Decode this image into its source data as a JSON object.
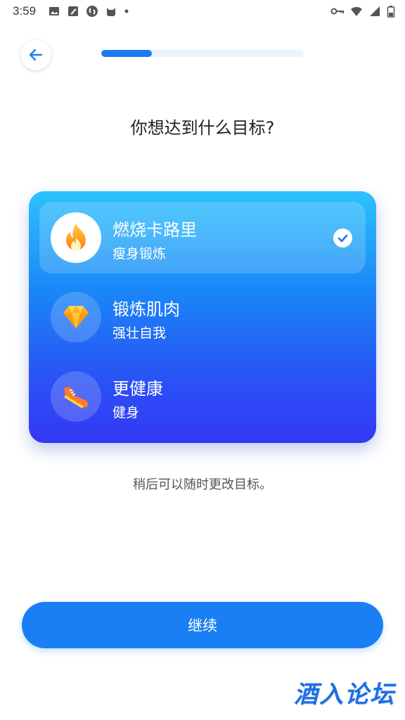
{
  "status_bar": {
    "time": "3:59",
    "left_icons": [
      "image-icon",
      "note-icon",
      "shazam-icon",
      "cat-icon",
      "dot-icon"
    ],
    "right_icons": [
      "vpn-key-icon",
      "wifi-icon",
      "signal-icon",
      "battery-icon"
    ]
  },
  "header": {
    "back_icon": "arrow-left-icon",
    "progress_fraction": 0.25
  },
  "question": "你想达到什么目标?",
  "goals": [
    {
      "title": "燃烧卡路里",
      "subtitle": "瘦身锻炼",
      "icon": "fire-icon",
      "selected": true
    },
    {
      "title": "锻炼肌肉",
      "subtitle": "强壮自我",
      "icon": "diamond-icon",
      "selected": false
    },
    {
      "title": "更健康",
      "subtitle": "健身",
      "icon": "sneaker-icon",
      "selected": false
    }
  ],
  "hint": "稍后可以随时更改目标。",
  "continue_label": "继续",
  "watermark": "酒入论坛",
  "colors": {
    "accent": "#1a7ff5",
    "card_top": "#2cc2fd",
    "card_bottom": "#3438f4"
  }
}
